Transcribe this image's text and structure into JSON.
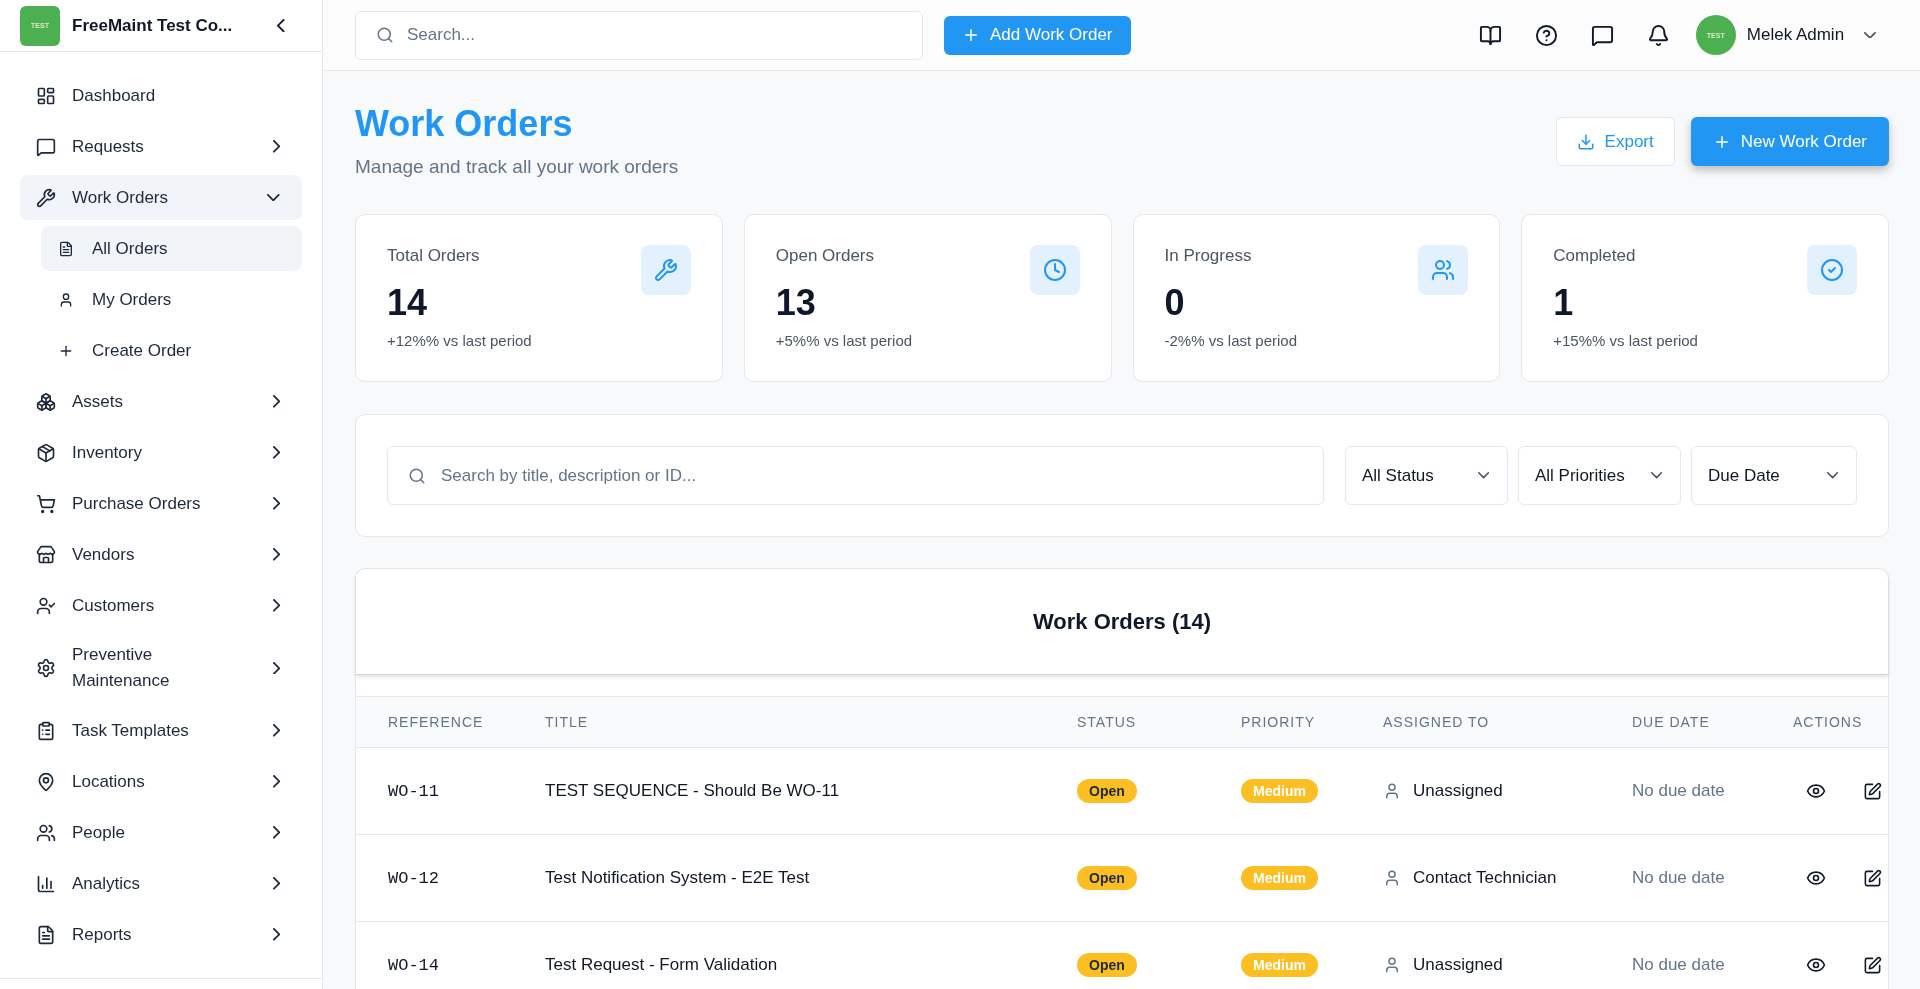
{
  "sidebar": {
    "logo_text": "TEST",
    "company": "FreeMaint Test Co...",
    "items": [
      {
        "kind": "link",
        "label": "Dashboard",
        "selected": false
      },
      {
        "kind": "group",
        "label": "Requests",
        "selected": false,
        "expanded": false
      },
      {
        "kind": "group",
        "label": "Work Orders",
        "selected": true,
        "expanded": true,
        "children": [
          {
            "label": "All Orders",
            "selected": true
          },
          {
            "label": "My Orders",
            "selected": false
          },
          {
            "label": "Create Order",
            "selected": false
          }
        ]
      },
      {
        "kind": "group",
        "label": "Assets",
        "selected": false,
        "expanded": false
      },
      {
        "kind": "group",
        "label": "Inventory",
        "selected": false,
        "expanded": false
      },
      {
        "kind": "group",
        "label": "Purchase Orders",
        "selected": false,
        "expanded": false
      },
      {
        "kind": "group",
        "label": "Vendors",
        "selected": false,
        "expanded": false
      },
      {
        "kind": "group",
        "label": "Customers",
        "selected": false,
        "expanded": false
      },
      {
        "kind": "group",
        "label": "Preventive Maintenance",
        "selected": false,
        "expanded": false
      },
      {
        "kind": "group",
        "label": "Task Templates",
        "selected": false,
        "expanded": false
      },
      {
        "kind": "group",
        "label": "Locations",
        "selected": false,
        "expanded": false
      },
      {
        "kind": "group",
        "label": "People",
        "selected": false,
        "expanded": false
      },
      {
        "kind": "group",
        "label": "Analytics",
        "selected": false,
        "expanded": false
      },
      {
        "kind": "group",
        "label": "Reports",
        "selected": false,
        "expanded": false
      }
    ]
  },
  "topbar": {
    "search": {
      "placeholder": "Search..."
    },
    "add_button": "Add Work Order",
    "user": {
      "avatar_text": "TEST",
      "name": "Melek Admin"
    }
  },
  "page_header": {
    "title": "Work Orders",
    "subtitle": "Manage and track all your work orders",
    "actions": [
      {
        "kind": "secondary",
        "label": "Export"
      },
      {
        "kind": "primary",
        "label": "New Work Order"
      }
    ]
  },
  "stats": [
    {
      "label": "Total Orders",
      "value": "14",
      "change": "+12%% vs last period"
    },
    {
      "label": "Open Orders",
      "value": "13",
      "change": "+5%% vs last period"
    },
    {
      "label": "In Progress",
      "value": "0",
      "change": "-2%% vs last period"
    },
    {
      "label": "Completed",
      "value": "1",
      "change": "+15%% vs last period"
    }
  ],
  "filters": {
    "search": {
      "placeholder": "Search by title, description or ID..."
    },
    "selects": [
      {
        "value": "All Status"
      },
      {
        "value": "All Priorities"
      },
      {
        "value": "Due Date"
      }
    ]
  },
  "table": {
    "title": "Work Orders (14)",
    "columns": [
      "REFERENCE",
      "TITLE",
      "STATUS",
      "PRIORITY",
      "ASSIGNED TO",
      "DUE DATE",
      "ACTIONS"
    ],
    "rows": [
      {
        "reference": "WO-11",
        "title": "TEST SEQUENCE - Should Be WO-11",
        "status": "Open",
        "priority": "Medium",
        "assigned_to": "Unassigned",
        "due_date": "No due date"
      },
      {
        "reference": "WO-12",
        "title": "Test Notification System - E2E Test",
        "status": "Open",
        "priority": "Medium",
        "assigned_to": "Contact Technician",
        "due_date": "No due date"
      },
      {
        "reference": "WO-14",
        "title": "Test Request - Form Validation",
        "status": "Open",
        "priority": "Medium",
        "assigned_to": "Unassigned",
        "due_date": "No due date"
      }
    ]
  }
}
